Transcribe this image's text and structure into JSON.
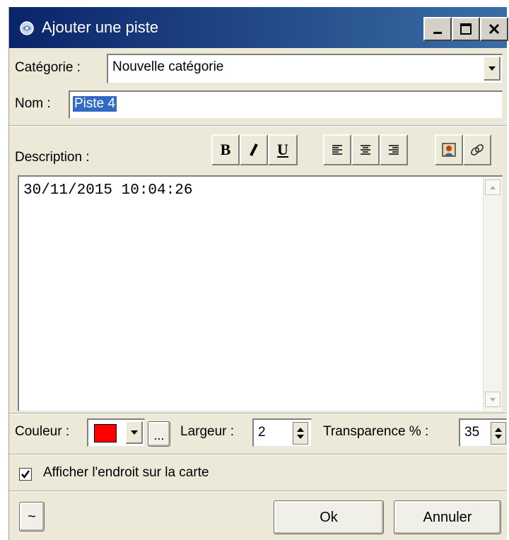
{
  "window": {
    "title": "Ajouter une piste",
    "minimize": "minimize",
    "maximize": "maximize",
    "close": "close"
  },
  "form": {
    "category_label": "Catégorie :",
    "category_value": "Nouvelle catégorie",
    "name_label": "Nom :",
    "name_value": "Piste 4",
    "description_label": "Description :",
    "description_value": "30/11/2015 10:04:26"
  },
  "toolbar": {
    "bold": "B",
    "italic": "I",
    "underline": "U"
  },
  "style": {
    "color_label": "Couleur :",
    "color_value": "#ff0000",
    "ellipsis_label": "...",
    "width_label": "Largeur :",
    "width_value": "2",
    "transparency_label": "Transparence % :",
    "transparency_value": "35"
  },
  "options": {
    "show_on_map_label": "Afficher l'endroit sur la carte",
    "show_on_map_checked": true
  },
  "buttons": {
    "tilde_label": "~",
    "ok_label": "Ok",
    "cancel_label": "Annuler"
  },
  "colors": {
    "titlebar_start": "#0a246a",
    "titlebar_end": "#3a6ea5",
    "selection": "#316ac5"
  }
}
